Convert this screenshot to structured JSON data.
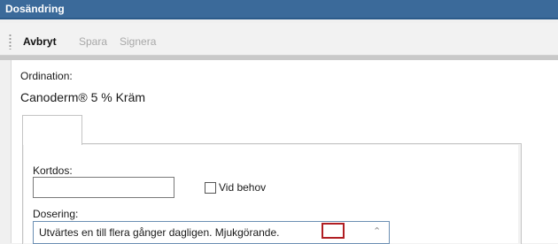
{
  "window": {
    "title": "Dosändring"
  },
  "toolbar": {
    "cancel_label": "Avbryt",
    "save_label": "Spara",
    "sign_label": "Signera"
  },
  "ordination": {
    "label": "Ordination:",
    "drug_name": "Canoderm® 5 % Kräm"
  },
  "form": {
    "kortdos_label": "Kortdos:",
    "kortdos_value": "",
    "vid_behov_label": "Vid behov",
    "vid_behov_checked": false,
    "dosering_label": "Dosering:",
    "dosering_value": "Utvärtes en till flera gånger dagligen. Mjukgörande."
  },
  "colors": {
    "titlebar": "#3b6a9a",
    "highlight_mark": "#b01e23"
  }
}
